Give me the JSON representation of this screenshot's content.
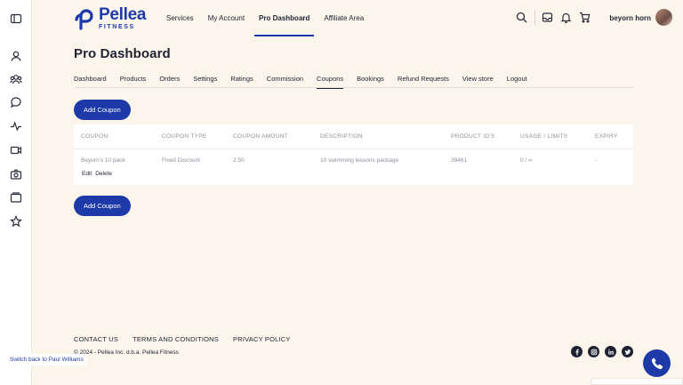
{
  "brand": {
    "name": "Pellea",
    "tagline": "FITNESS",
    "color": "#1e3aa8"
  },
  "header": {
    "nav": [
      "Services",
      "My Account",
      "Pro Dashboard",
      "Affiliate Area"
    ],
    "active_nav": "Pro Dashboard",
    "username": "beyorn horn",
    "icons": [
      "search-icon",
      "inbox-icon",
      "bell-icon",
      "cart-icon"
    ]
  },
  "sidebar": {
    "icons": [
      "panel-toggle-icon",
      "user-icon",
      "users-icon",
      "chat-icon",
      "activity-icon",
      "video-icon",
      "camera-icon",
      "folder-icon",
      "star-icon"
    ]
  },
  "main": {
    "title": "Pro Dashboard",
    "tabs": [
      "Dashboard",
      "Products",
      "Orders",
      "Settings",
      "Ratings",
      "Commission",
      "Coupons",
      "Bookings",
      "Refund Requests",
      "View store",
      "Logout"
    ],
    "active_tab": "Coupons",
    "add_coupon_label": "Add Coupon",
    "table": {
      "headers": [
        "COUPON",
        "COUPON TYPE",
        "COUPON AMOUNT",
        "DESCRIPTION",
        "PRODUCT ID'S",
        "USAGE / LIMITS",
        "EXPIRY"
      ],
      "rows": [
        {
          "cells": [
            "Beyorn's 10 pack",
            "Fixed Discount",
            "2.50",
            "10 swimming lessons package",
            "39461",
            "0 / ∞",
            "-"
          ],
          "actions": [
            "Edit",
            "Delete"
          ]
        }
      ]
    }
  },
  "footer": {
    "links": [
      "CONTACT US",
      "TERMS AND CONDITIONS",
      "PRIVACY POLICY"
    ],
    "copyright": "© 2024 - Pellea Inc. d.b.a. Pellea Fitness",
    "social": [
      "facebook-icon",
      "instagram-icon",
      "linkedin-icon",
      "twitter-icon"
    ]
  },
  "switch_user_label": "Switch back to Paul Williams"
}
